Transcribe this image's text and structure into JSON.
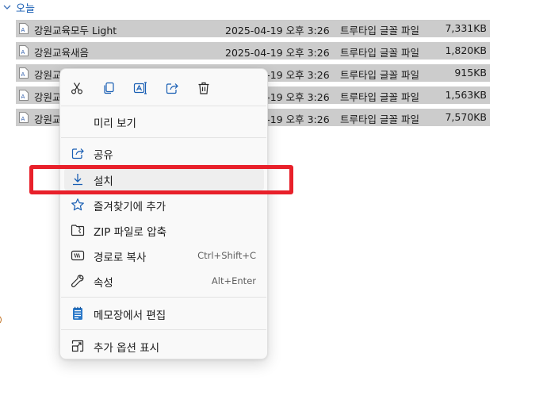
{
  "group": {
    "label": "오늘"
  },
  "files": [
    {
      "name": "강원교육모두 Light",
      "date": "2025-04-19 오후 3:26",
      "type": "트루타입 글꼴 파일",
      "size": "7,331KB"
    },
    {
      "name": "강원교육새음",
      "date": "2025-04-19 오후 3:26",
      "type": "트루타입 글꼴 파일",
      "size": "1,820KB"
    },
    {
      "name": "강원교",
      "date": "2025-04-19 오후 3:26",
      "type": "트루타입 글꼴 파일",
      "size": "915KB"
    },
    {
      "name": "강원교",
      "date": "2025-04-19 오후 3:26",
      "type": "트루타입 글꼴 파일",
      "size": "1,563KB"
    },
    {
      "name": "강원교",
      "date": "2025-04-19 오후 3:26",
      "type": "트루타입 글꼴 파일",
      "size": "7,570KB"
    }
  ],
  "toolbar": {
    "icons": [
      "cut-icon",
      "copy-icon",
      "rename-icon",
      "share-icon",
      "delete-icon"
    ]
  },
  "menu": {
    "preview": "미리 보기",
    "share": "공유",
    "install": "설치",
    "favorites": "즐겨찾기에 추가",
    "zip": "ZIP 파일로 압축",
    "copy_path": "경로로 복사",
    "copy_path_shortcut": "Ctrl+Shift+C",
    "properties": "속성",
    "properties_shortcut": "Alt+Enter",
    "notepad": "메모장에서 편집",
    "more_options": "추가 옵션 표시"
  },
  "colors": {
    "accent": "#1a5fb4",
    "highlight": "#e8202a",
    "selected_row": "#cccccc"
  }
}
